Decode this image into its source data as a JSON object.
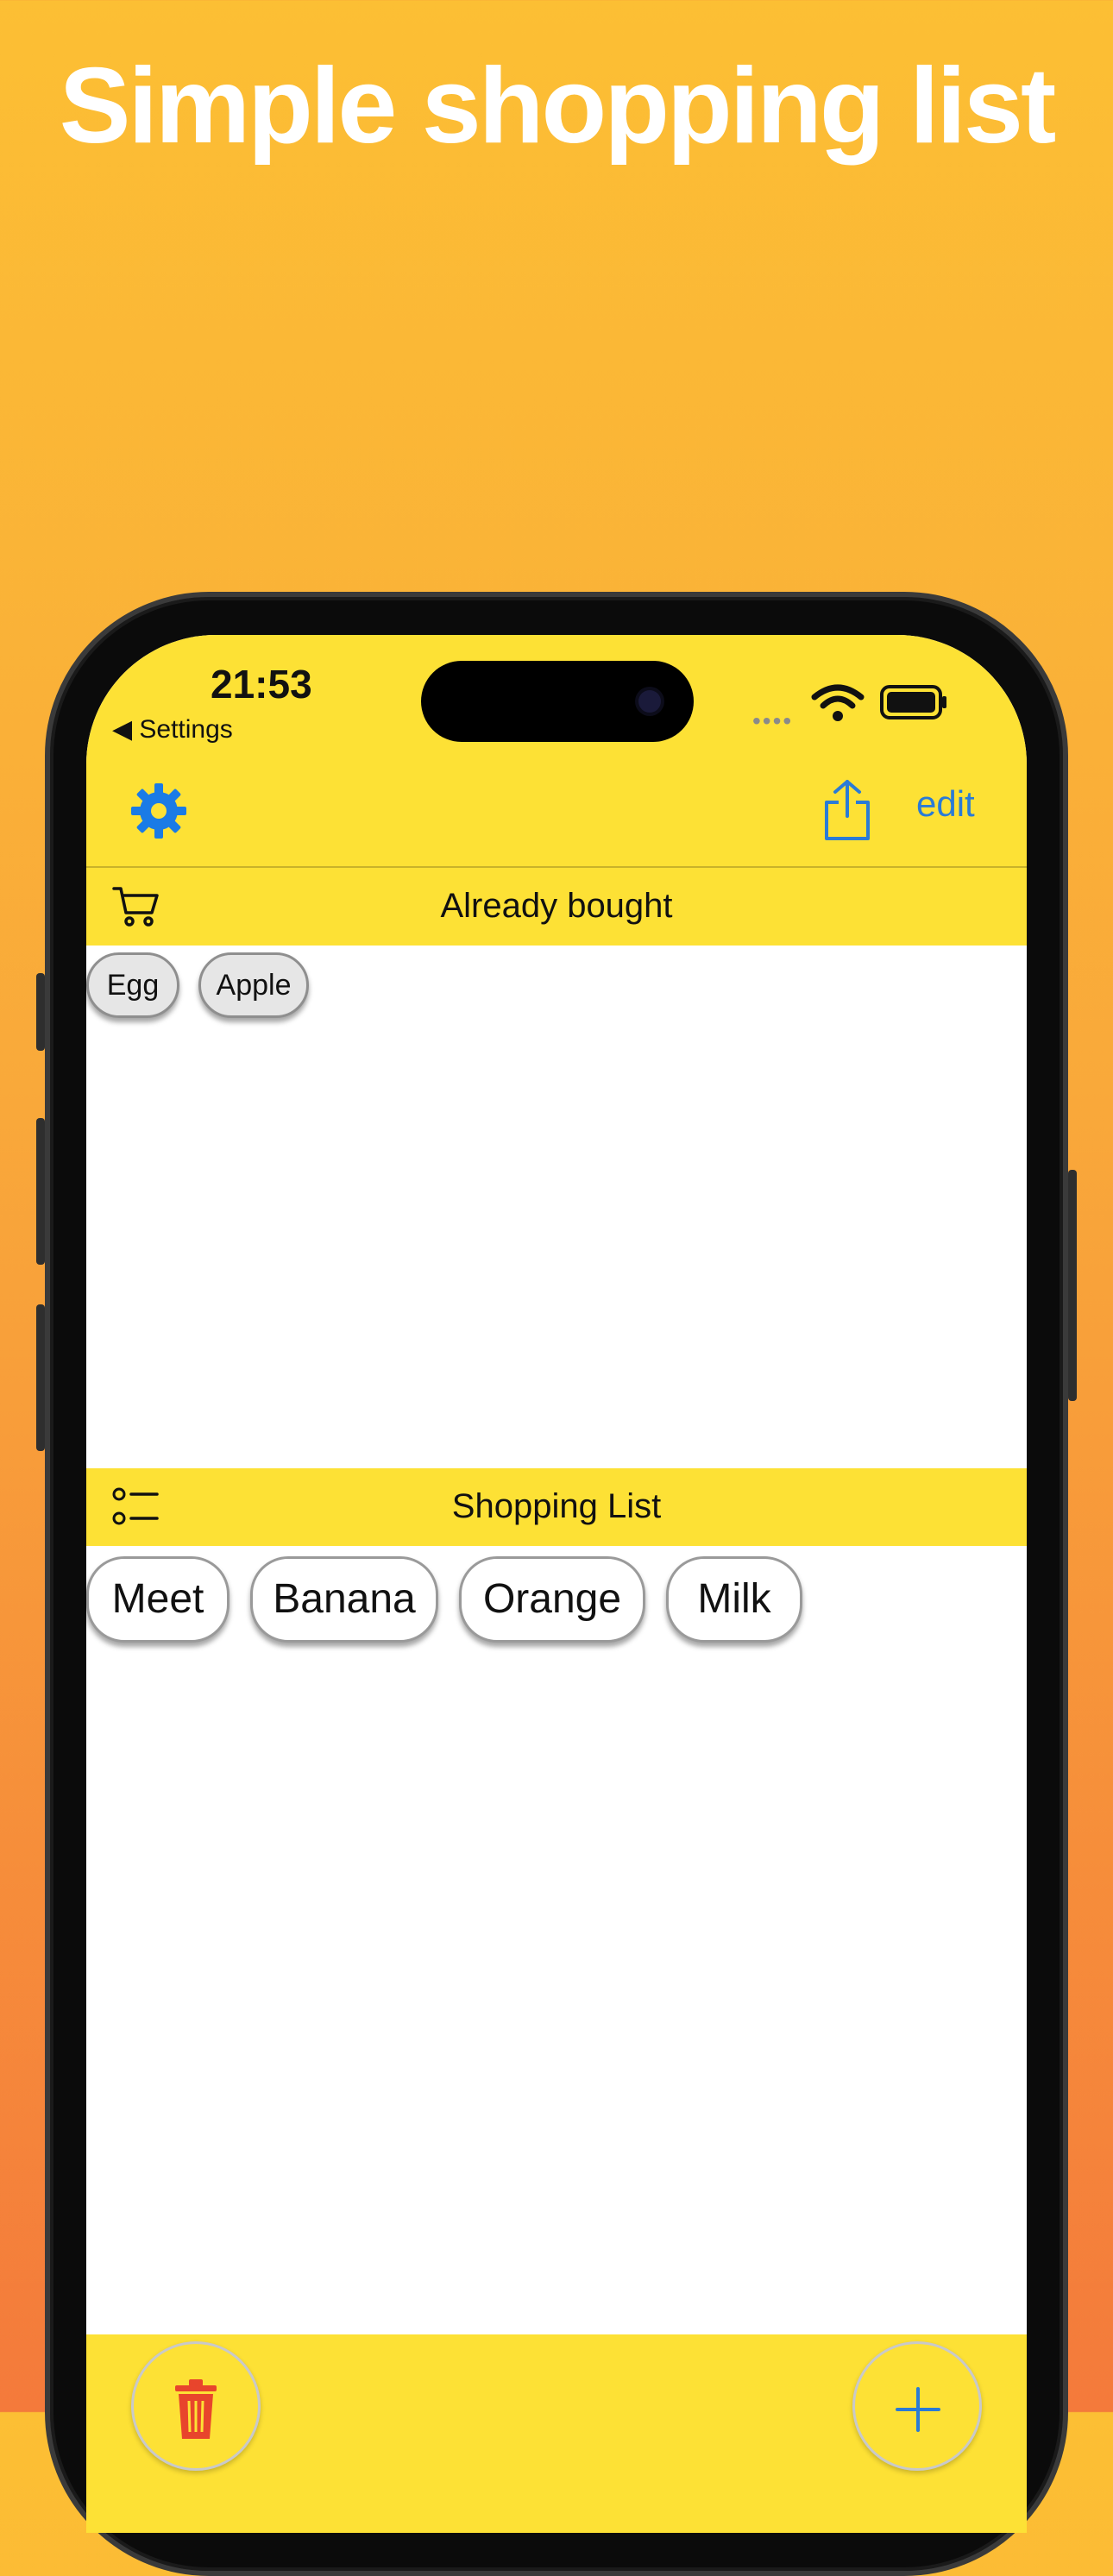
{
  "headline": "Simple shopping list",
  "status": {
    "time": "21:53",
    "back_label": "◀ Settings"
  },
  "toolbar": {
    "edit_label": "edit"
  },
  "sections": {
    "bought": {
      "title": "Already bought",
      "items": [
        "Egg",
        "Apple"
      ]
    },
    "shopping": {
      "title": "Shopping List",
      "items": [
        "Meet",
        "Banana",
        "Orange",
        "Milk"
      ]
    }
  },
  "colors": {
    "accent_blue": "#2a7bd6",
    "bar_yellow": "#fde135",
    "delete_red": "#e8452c",
    "background_top": "#fcbf34",
    "background_bottom": "#f47a3b"
  },
  "icons": {
    "settings": "gear-icon",
    "share": "share-icon",
    "bought": "cart-icon",
    "shopping": "checklist-icon",
    "delete": "trash-icon",
    "add": "plus-icon"
  }
}
